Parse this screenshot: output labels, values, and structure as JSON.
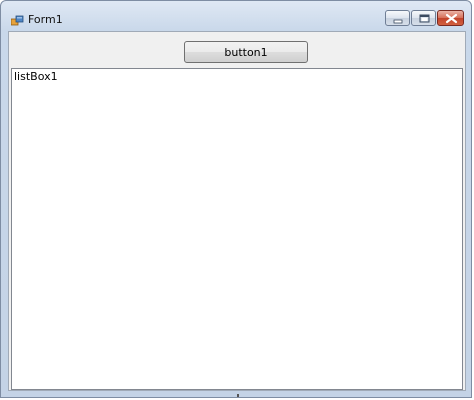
{
  "window": {
    "title": "Form1",
    "icon": "winforms-app-icon"
  },
  "caption_buttons": {
    "minimize_icon": "minimize-icon",
    "maximize_icon": "restore-icon",
    "close_icon": "close-icon"
  },
  "form": {
    "button1_label": "button1",
    "listbox_items": [
      "listBox1"
    ]
  },
  "colors": {
    "titlebar": "#c9d8ea",
    "client_background": "#f0f0f0",
    "close_button": "#c2432b"
  }
}
